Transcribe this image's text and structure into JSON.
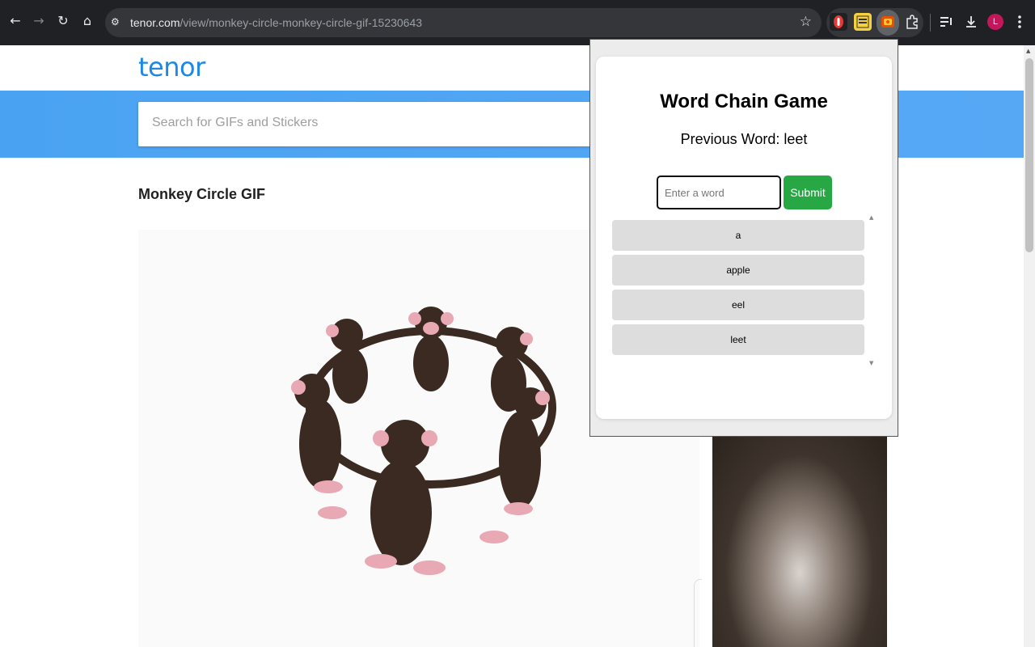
{
  "browser": {
    "url_host": "tenor.com",
    "url_path": "/view/monkey-circle-monkey-circle-gif-15230643",
    "avatar_letter": "L"
  },
  "tenor": {
    "logo": "tenor",
    "search_placeholder": "Search for GIFs and Stickers",
    "gif_title": "Monkey Circle GIF"
  },
  "popup": {
    "title": "Word Chain Game",
    "previous_word": "Previous Word: leet",
    "input_placeholder": "Enter a word",
    "submit_label": "Submit",
    "words": [
      "a",
      "apple",
      "eel",
      "leet"
    ]
  },
  "colors": {
    "toolbar": "#202124",
    "tenor_blue": "#4aa3f2",
    "submit_green": "#28a745"
  }
}
